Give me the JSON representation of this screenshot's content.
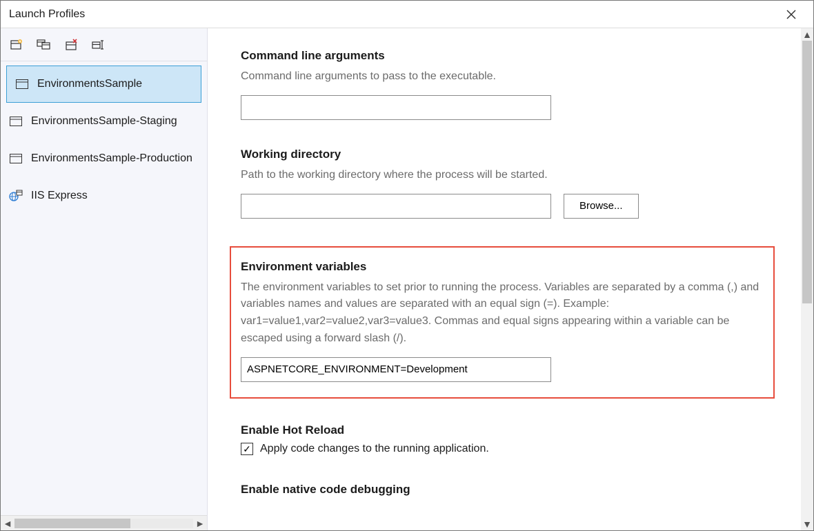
{
  "dialog": {
    "title": "Launch Profiles"
  },
  "toolbar": {
    "new_profile": "new-profile-icon",
    "duplicate_profile": "duplicate-profile-icon",
    "delete_profile": "delete-profile-icon",
    "rename_profile": "rename-profile-icon"
  },
  "profiles": {
    "items": [
      {
        "label": "EnvironmentsSample",
        "icon": "window",
        "selected": true
      },
      {
        "label": "EnvironmentsSample-Staging",
        "icon": "window",
        "selected": false
      },
      {
        "label": "EnvironmentsSample-Production",
        "icon": "window",
        "selected": false
      },
      {
        "label": "IIS Express",
        "icon": "iis",
        "selected": false
      }
    ]
  },
  "sections": {
    "cmdline": {
      "title": "Command line arguments",
      "description": "Command line arguments to pass to the executable.",
      "value": ""
    },
    "workdir": {
      "title": "Working directory",
      "description": "Path to the working directory where the process will be started.",
      "value": "",
      "browse_label": "Browse..."
    },
    "envvars": {
      "title": "Environment variables",
      "description": "The environment variables to set prior to running the process. Variables are separated by a comma (,) and variables names and values are separated with an equal sign (=). Example: var1=value1,var2=value2,var3=value3. Commas and equal signs appearing within a variable can be escaped using a forward slash (/).",
      "value": "ASPNETCORE_ENVIRONMENT=Development"
    },
    "hotreload": {
      "title": "Enable Hot Reload",
      "checkbox_label": "Apply code changes to the running application.",
      "checked": true
    },
    "nativedebug": {
      "title": "Enable native code debugging"
    }
  }
}
